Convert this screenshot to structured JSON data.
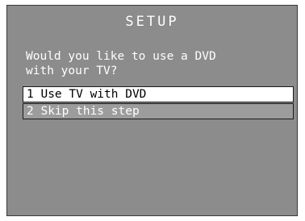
{
  "title": "SETUP",
  "prompt": "Would you like to use a DVD\nwith your TV?",
  "options": [
    {
      "label": "1 Use TV with DVD",
      "selected": true
    },
    {
      "label": "2 Skip this step",
      "selected": false
    }
  ],
  "colors": {
    "panel": "#8c8c8c",
    "selected_bg": "#ffffff",
    "unselected_bg": "#9c9c9c",
    "text": "#ffffff"
  }
}
